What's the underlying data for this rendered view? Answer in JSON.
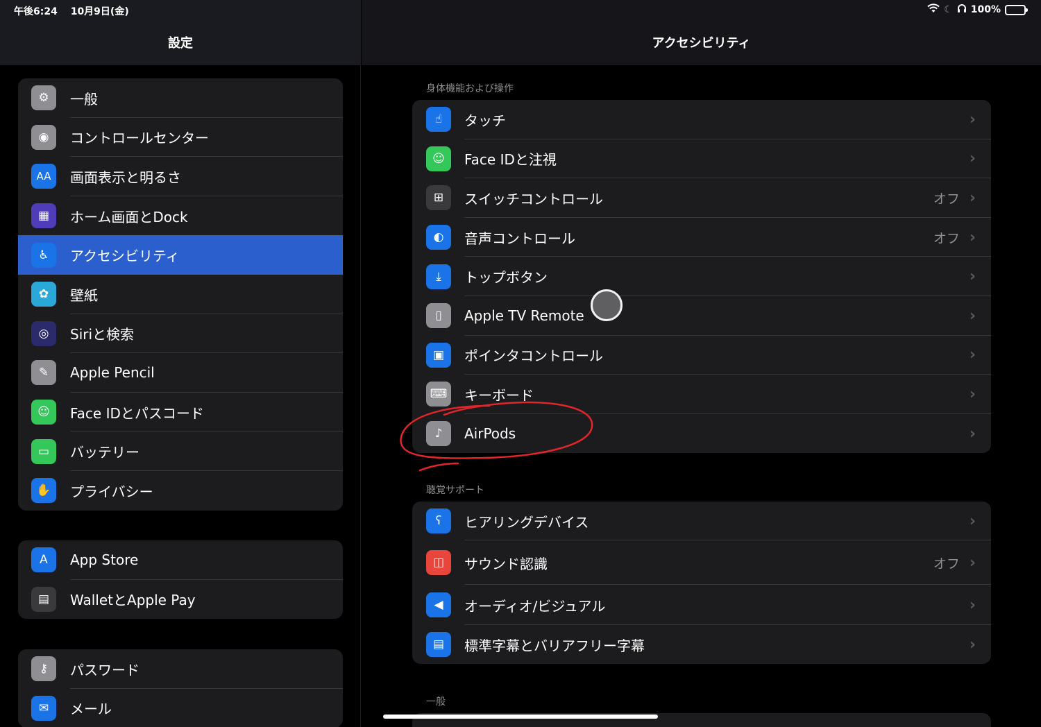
{
  "status": {
    "time": "午後6:24",
    "date": "10月9日(金)",
    "battery": "100%"
  },
  "left": {
    "title": "設定",
    "groups": [
      {
        "items": [
          {
            "label": "一般",
            "icon": "gear-icon",
            "color": "#8e8e93"
          },
          {
            "label": "コントロールセンター",
            "icon": "toggles-icon",
            "color": "#8e8e93"
          },
          {
            "label": "画面表示と明るさ",
            "icon": "text-size-icon",
            "color": "#1a74e8"
          },
          {
            "label": "ホーム画面とDock",
            "icon": "home-grid-icon",
            "color": "#4e3cb8"
          },
          {
            "label": "アクセシビリティ",
            "icon": "accessibility-icon",
            "color": "#1a74e8",
            "selected": true
          },
          {
            "label": "壁紙",
            "icon": "flower-icon",
            "color": "#2aa8d8"
          },
          {
            "label": "Siriと検索",
            "icon": "siri-icon",
            "color": "#2b2b6b"
          },
          {
            "label": "Apple Pencil",
            "icon": "pencil-icon",
            "color": "#8e8e93"
          },
          {
            "label": "Face IDとパスコード",
            "icon": "face-id-icon",
            "color": "#34c759"
          },
          {
            "label": "バッテリー",
            "icon": "battery-icon",
            "color": "#34c759"
          },
          {
            "label": "プライバシー",
            "icon": "hand-icon",
            "color": "#1a74e8"
          }
        ]
      },
      {
        "items": [
          {
            "label": "App Store",
            "icon": "app-store-icon",
            "color": "#1a74e8"
          },
          {
            "label": "WalletとApple Pay",
            "icon": "wallet-icon",
            "color": "#3a3a3c"
          }
        ]
      },
      {
        "items": [
          {
            "label": "パスワード",
            "icon": "key-icon",
            "color": "#8e8e93"
          },
          {
            "label": "メール",
            "icon": "mail-icon",
            "color": "#1a74e8"
          }
        ]
      }
    ]
  },
  "right": {
    "title": "アクセシビリティ",
    "sections": [
      {
        "header": "身体機能および操作",
        "items": [
          {
            "label": "タッチ",
            "icon": "touch-hand-icon",
            "color": "#1a74e8",
            "value": ""
          },
          {
            "label": "Face IDと注視",
            "icon": "face-id-icon",
            "color": "#34c759",
            "value": ""
          },
          {
            "label": "スイッチコントロール",
            "icon": "switch-grid-icon",
            "color": "#3a3a3c",
            "value": "オフ"
          },
          {
            "label": "音声コントロール",
            "icon": "voice-control-icon",
            "color": "#1a74e8",
            "value": "オフ"
          },
          {
            "label": "トップボタン",
            "icon": "top-button-icon",
            "color": "#1a74e8",
            "value": ""
          },
          {
            "label": "Apple TV Remote",
            "icon": "remote-icon",
            "color": "#8e8e93",
            "value": ""
          },
          {
            "label": "ポインタコントロール",
            "icon": "pointer-icon",
            "color": "#1a74e8",
            "value": ""
          },
          {
            "label": "キーボード",
            "icon": "keyboard-icon",
            "color": "#8e8e93",
            "value": ""
          },
          {
            "label": "AirPods",
            "icon": "airpods-icon",
            "color": "#8e8e93",
            "value": ""
          }
        ]
      },
      {
        "header": "聴覚サポート",
        "items": [
          {
            "label": "ヒアリングデバイス",
            "icon": "ear-icon",
            "color": "#1a74e8",
            "value": ""
          },
          {
            "label": "サウンド認識",
            "icon": "sound-recognition-icon",
            "color": "#e8453c",
            "value": "オフ"
          },
          {
            "label": "オーディオ/ビジュアル",
            "icon": "audio-visual-icon",
            "color": "#1a74e8",
            "value": ""
          },
          {
            "label": "標準字幕とバリアフリー字幕",
            "icon": "subtitles-icon",
            "color": "#1a74e8",
            "value": ""
          }
        ]
      },
      {
        "header": "一般",
        "items": []
      }
    ]
  }
}
